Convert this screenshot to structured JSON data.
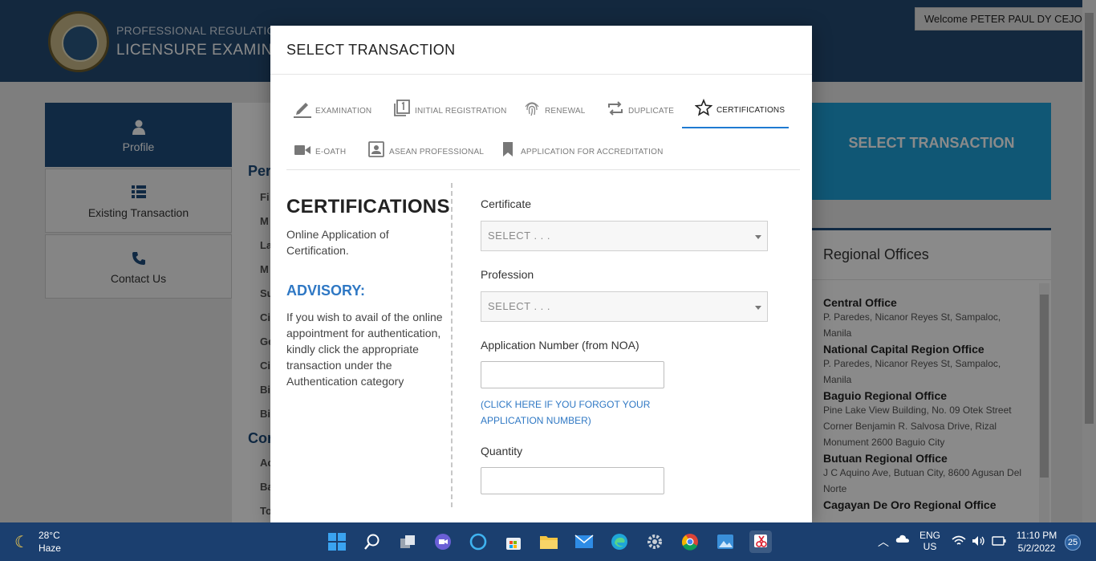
{
  "background": {
    "org_name": "PROFESSIONAL REGULATION C",
    "system_name": "LICENSURE EXAMINA",
    "welcome": "Welcome PETER PAUL DY CEJOCO",
    "sidebar": [
      {
        "label": "Profile",
        "icon": "person-icon"
      },
      {
        "label": "Existing Transaction",
        "icon": "list-icon"
      },
      {
        "label": "Contact Us",
        "icon": "phone-icon"
      }
    ],
    "mid_headings": [
      "Per",
      "Cor"
    ],
    "mid_lines": [
      "Fi",
      "M",
      "La",
      "M",
      "Su",
      "Ci",
      "Ge",
      "Ci",
      "Bi",
      "Bi",
      "Ac",
      "Ba",
      "To"
    ],
    "select_tile": "SELECT TRANSACTION",
    "regional": {
      "title": "Regional Offices",
      "offices": [
        {
          "name": "Central Office",
          "address": "P. Paredes, Nicanor Reyes St, Sampaloc, Manila"
        },
        {
          "name": "National Capital Region Office",
          "address": "P. Paredes, Nicanor Reyes St, Sampaloc, Manila"
        },
        {
          "name": "Baguio Regional Office",
          "address": "Pine Lake View Building, No. 09 Otek Street Corner Benjamin R. Salvosa Drive, Rizal Monument 2600 Baguio City"
        },
        {
          "name": "Butuan Regional Office",
          "address": "J C Aquino Ave, Butuan City, 8600 Agusan Del Norte"
        },
        {
          "name": "Cagayan De Oro Regional Office",
          "address": ""
        }
      ]
    }
  },
  "modal": {
    "title": "SELECT TRANSACTION",
    "tabs": [
      {
        "label": "EXAMINATION",
        "icon": "pencil-icon"
      },
      {
        "label": "INITIAL REGISTRATION",
        "icon": "copy-one-icon"
      },
      {
        "label": "RENEWAL",
        "icon": "fingerprint-icon"
      },
      {
        "label": "DUPLICATE",
        "icon": "repeat-icon"
      },
      {
        "label": "CERTIFICATIONS",
        "icon": "star-icon"
      },
      {
        "label": "E-OATH",
        "icon": "video-camera-icon"
      },
      {
        "label": "ASEAN PROFESSIONAL",
        "icon": "id-badge-icon"
      },
      {
        "label": "APPLICATION FOR ACCREDITATION",
        "icon": "bookmark-icon"
      }
    ],
    "active_tab": "CERTIFICATIONS",
    "heading": "CERTIFICATIONS",
    "subheading": "Online Application of Certification.",
    "advisory_title": "ADVISORY:",
    "advisory_text": "If you wish to avail of the online appointment for authentication, kindly click the appropriate transaction under the Authentication category",
    "form": {
      "certificate_label": "Certificate",
      "certificate_value": "SELECT . . .",
      "profession_label": "Profession",
      "profession_value": "SELECT . . .",
      "appno_label": "Application Number (from NOA)",
      "appno_value": "",
      "forgot_link": "(CLICK HERE IF YOU FORGOT YOUR APPLICATION NUMBER)",
      "quantity_label": "Quantity",
      "quantity_value": ""
    }
  },
  "taskbar": {
    "temperature": "28°C",
    "weather": "Haze",
    "language": "ENG",
    "region": "US",
    "time": "11:10 PM",
    "date": "5/2/2022",
    "notifications": "25"
  }
}
